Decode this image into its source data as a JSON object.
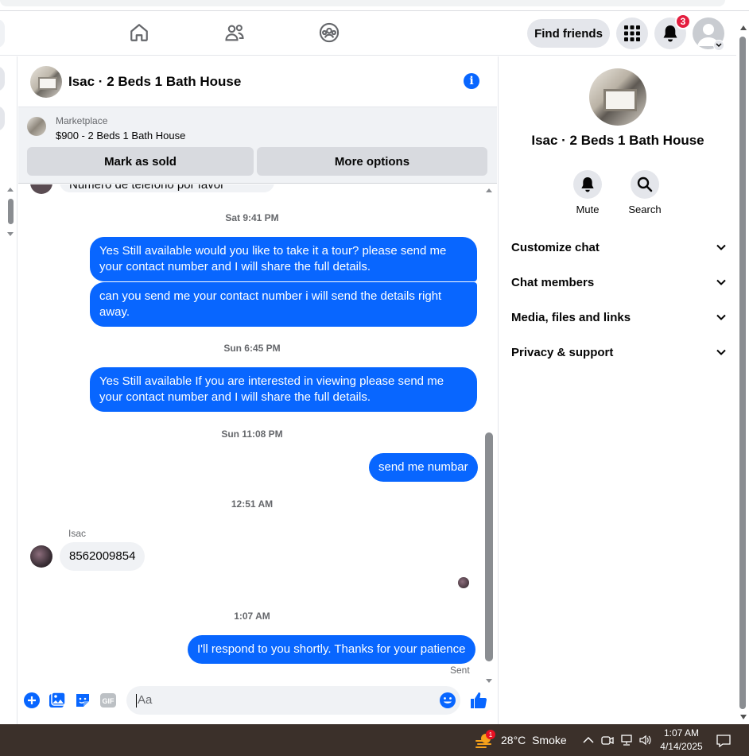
{
  "topnav": {
    "find_friends_label": "Find friends",
    "notification_count": "3",
    "icons": [
      "home-icon",
      "friends-icon",
      "groups-icon",
      "menu-grid-icon",
      "bell-icon",
      "profile-avatar"
    ]
  },
  "conversation": {
    "title": "Isac · 2 Beds 1 Bath House",
    "marketplace": {
      "label": "Marketplace",
      "listing": "$900 - 2 Beds 1 Bath House",
      "mark_sold_label": "Mark as sold",
      "more_options_label": "More options"
    },
    "partial_message": "Numero de telefono por favor gracias",
    "messages": [
      {
        "type": "timestamp",
        "text": "Sat 9:41 PM"
      },
      {
        "type": "outgoing",
        "text": "Yes Still available would you like to take it a tour? please send me your contact number and I will share the full details."
      },
      {
        "type": "outgoing",
        "text": "can you send me your contact number i will send the details right away."
      },
      {
        "type": "timestamp",
        "text": "Sun 6:45 PM"
      },
      {
        "type": "outgoing",
        "text": "Yes Still available If you are interested in viewing please send me your contact number and I will share the full details."
      },
      {
        "type": "timestamp",
        "text": "Sun 11:08 PM"
      },
      {
        "type": "outgoing",
        "text": "send me numbar"
      },
      {
        "type": "timestamp",
        "text": "12:51 AM"
      },
      {
        "type": "sender",
        "text": "Isac"
      },
      {
        "type": "incoming",
        "text": "8562009854"
      },
      {
        "type": "timestamp",
        "text": "1:07 AM"
      },
      {
        "type": "outgoing",
        "text": "I'll respond to you shortly. Thanks for your patience"
      }
    ],
    "sent_status": "Sent",
    "composer_placeholder": "Aa"
  },
  "info_panel": {
    "name": "Isac · 2 Beds 1 Bath House",
    "actions": [
      {
        "label": "Mute",
        "icon": "bell-icon"
      },
      {
        "label": "Search",
        "icon": "search-icon"
      }
    ],
    "sections": [
      {
        "label": "Customize chat"
      },
      {
        "label": "Chat members"
      },
      {
        "label": "Media, files and links"
      },
      {
        "label": "Privacy & support"
      }
    ]
  },
  "taskbar": {
    "weather": {
      "temp": "28°C",
      "condition": "Smoke",
      "alert_count": "1"
    },
    "time": "1:07 AM",
    "date": "4/14/2025"
  },
  "colors": {
    "accent": "#0866ff",
    "bubble_in": "#f0f2f5",
    "badge": "#e41e3f",
    "taskbar": "#3b302a"
  }
}
